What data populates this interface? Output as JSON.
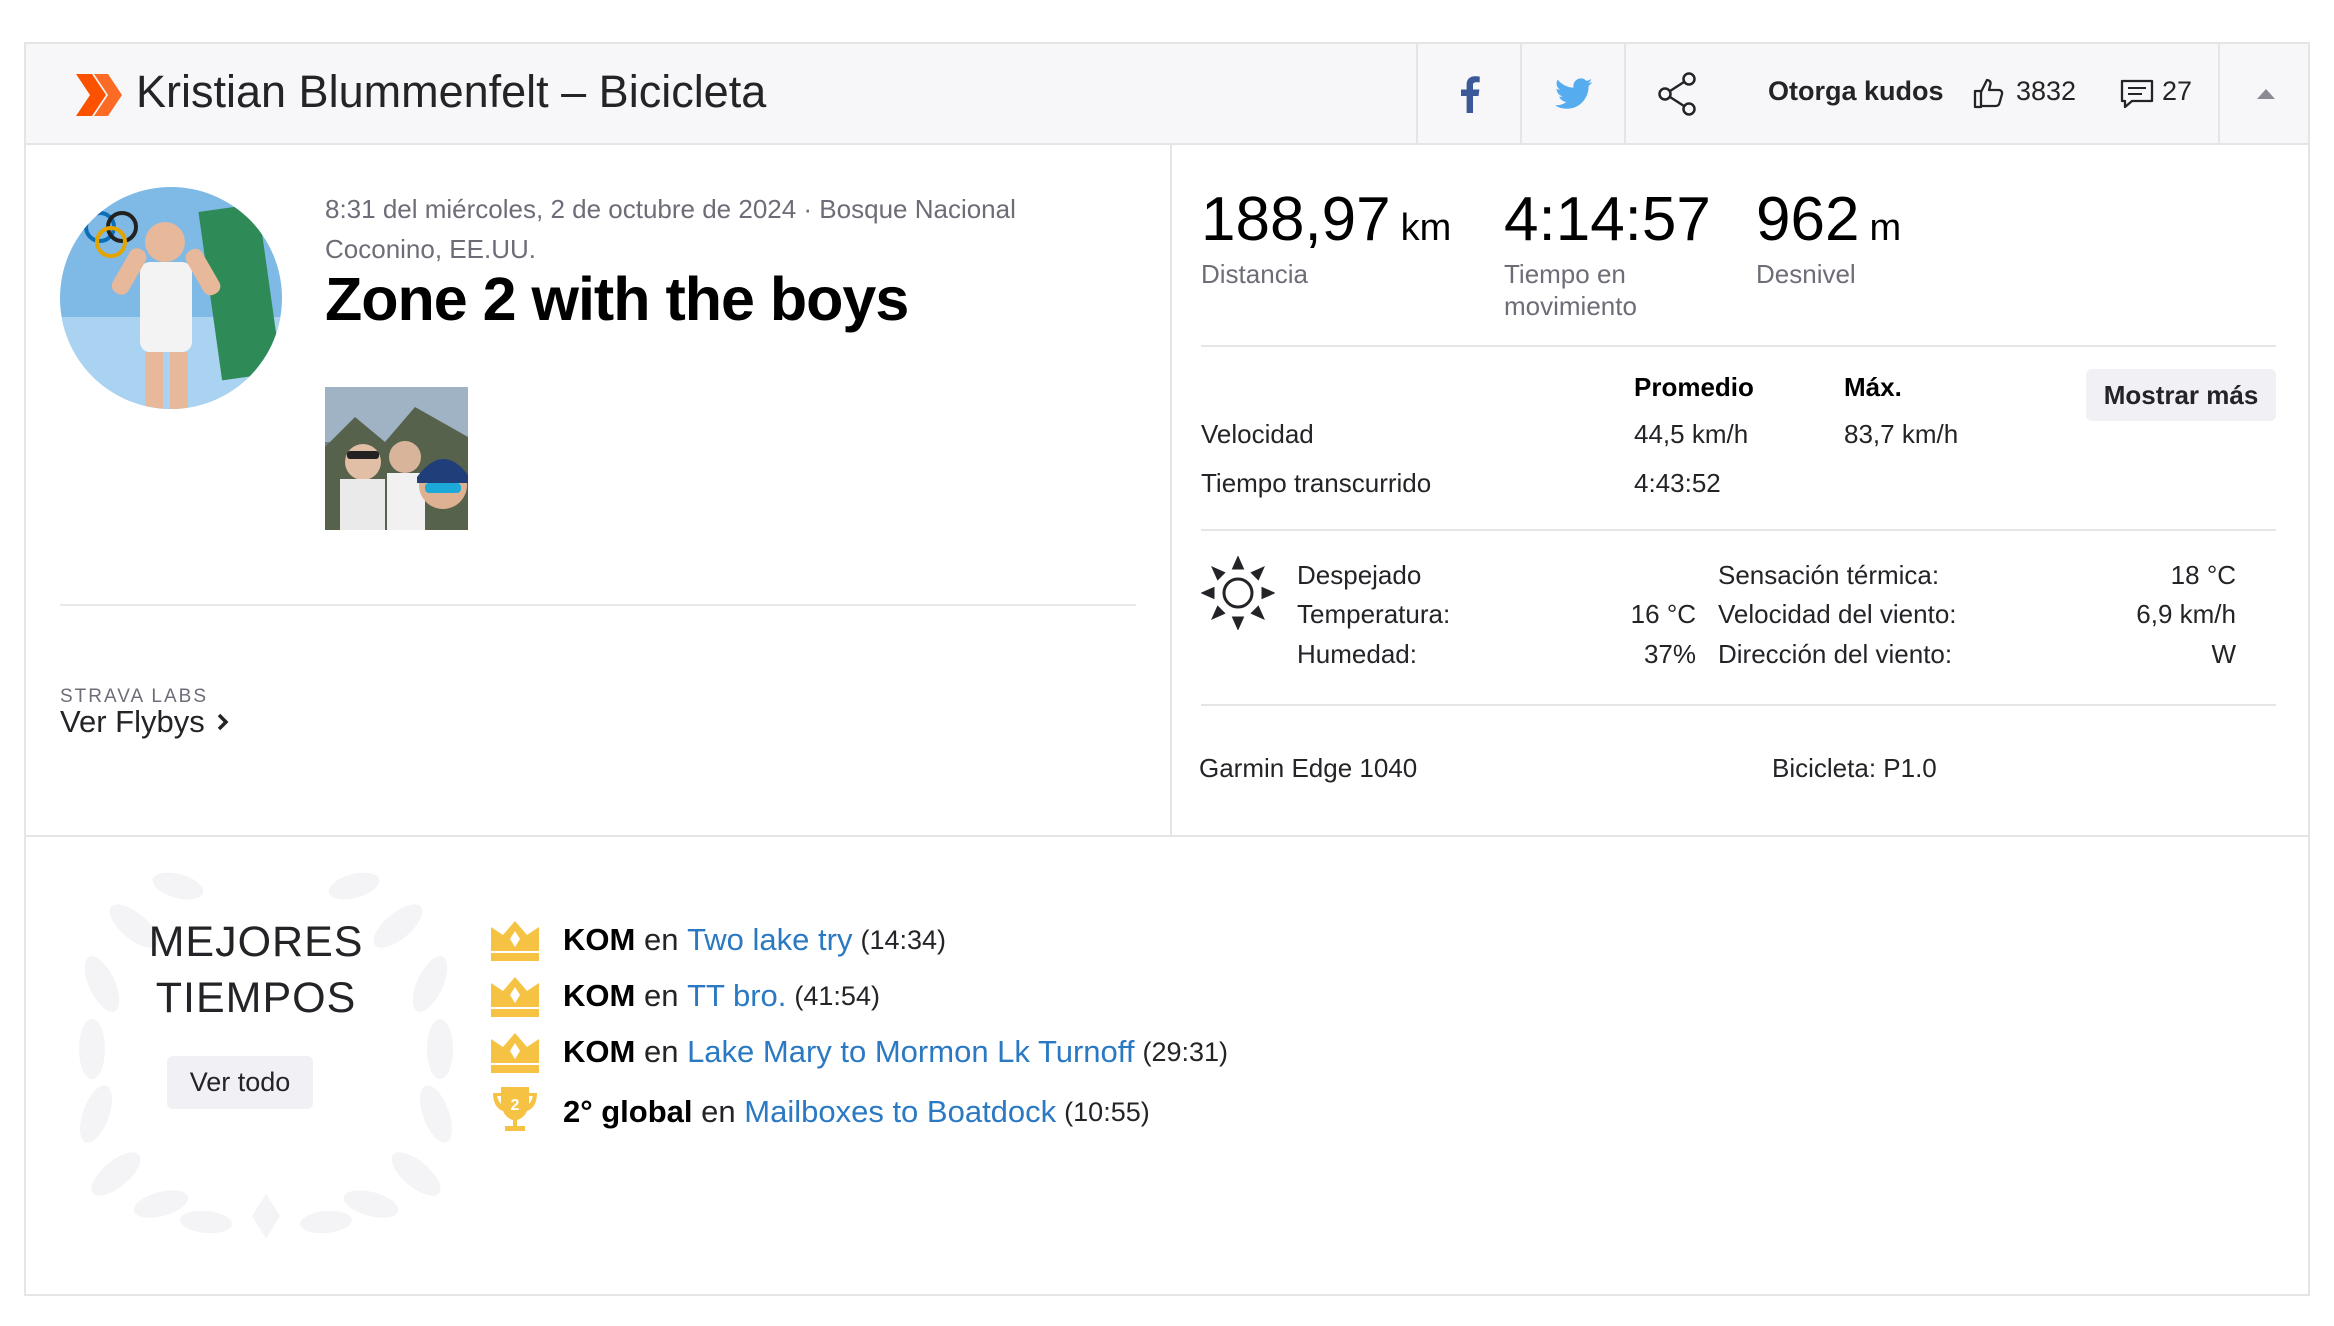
{
  "header": {
    "title": "Kristian Blummenfelt – Bicicleta",
    "give_kudos": "Otorga kudos",
    "kudos_count": "3832",
    "comments_count": "27",
    "brand_color": "#fc5200"
  },
  "activity": {
    "datetime_location": "8:31 del miércoles, 2 de octubre de 2024 · Bosque Nacional Coconino, EE.UU.",
    "name": "Zone 2 with the boys",
    "labs_label": "STRAVA LABS",
    "flyby_label": "Ver Flybys"
  },
  "stats": {
    "distance": {
      "value": "188,97",
      "unit": "km",
      "label": "Distancia"
    },
    "moving_time": {
      "value": "4:14:57",
      "unit": "",
      "label": "Tiempo en movimiento"
    },
    "elevation": {
      "value": "962",
      "unit": "m",
      "label": "Desnivel"
    },
    "col_avg": "Promedio",
    "col_max": "Máx.",
    "show_more": "Mostrar más",
    "rows": [
      {
        "label": "Velocidad",
        "avg": "44,5 km/h",
        "max": "83,7 km/h"
      },
      {
        "label": "Tiempo transcurrido",
        "avg": "4:43:52",
        "max": ""
      }
    ]
  },
  "weather": {
    "condition": "Despejado",
    "temperature_label": "Temperatura:",
    "temperature": "16 °C",
    "humidity_label": "Humedad:",
    "humidity": "37%",
    "feels_like_label": "Sensación térmica:",
    "feels_like": "18 °C",
    "wind_speed_label": "Velocidad del viento:",
    "wind_speed": "6,9 km/h",
    "wind_dir_label": "Dirección del viento:",
    "wind_dir": "W"
  },
  "gear": {
    "device": "Garmin Edge 1040",
    "bike": "Bicicleta: P1.0"
  },
  "best_efforts": {
    "title_line1": "MEJORES",
    "title_line2": "TIEMPOS",
    "view_all": "Ver todo",
    "items": [
      {
        "icon": "crown-icon",
        "rank": "KOM",
        "prep": "en",
        "segment": "Two lake try",
        "time": "(14:34)"
      },
      {
        "icon": "crown-icon",
        "rank": "KOM",
        "prep": "en",
        "segment": "TT bro.",
        "time": "(41:54)"
      },
      {
        "icon": "crown-icon",
        "rank": "KOM",
        "prep": "en",
        "segment": "Lake Mary to Mormon Lk Turnoff",
        "time": "(29:31)"
      },
      {
        "icon": "trophy-icon",
        "trophy_number": "2",
        "rank": "2° global",
        "prep": "en",
        "segment": "Mailboxes to Boatdock",
        "time": "(10:55)"
      }
    ]
  }
}
